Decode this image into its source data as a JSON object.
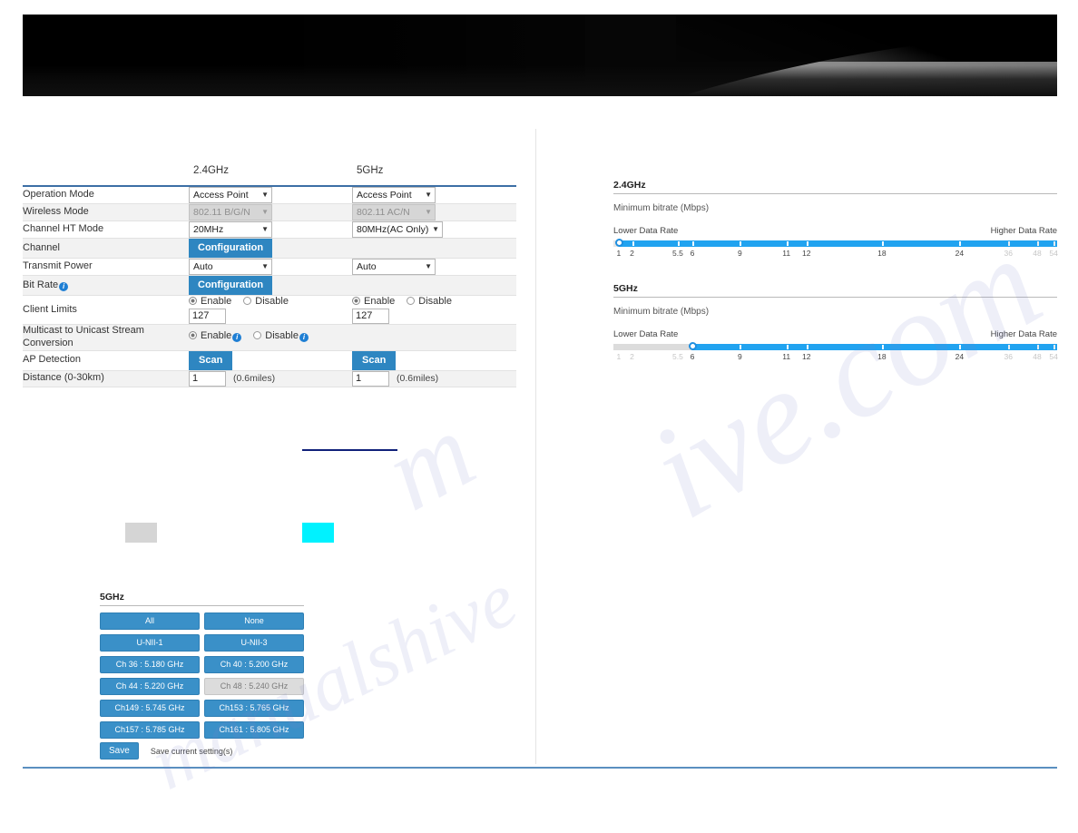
{
  "header": {
    "banner_alt": "product-banner"
  },
  "settings": {
    "columns": {
      "band_24": "2.4GHz",
      "band_5": "5GHz"
    },
    "rows": [
      {
        "label": "Operation Mode",
        "type": "select",
        "c24": {
          "value": "Access Point",
          "disabled": false
        },
        "c5": {
          "value": "Access Point",
          "disabled": false
        }
      },
      {
        "label": "Wireless Mode",
        "type": "select",
        "c24": {
          "value": "802.11 B/G/N",
          "disabled": true
        },
        "c5": {
          "value": "802.11 AC/N",
          "disabled": true
        }
      },
      {
        "label": "Channel HT Mode",
        "type": "select",
        "c24": {
          "value": "20MHz",
          "disabled": false
        },
        "c5": {
          "value": "80MHz(AC Only)",
          "disabled": false
        }
      },
      {
        "label": "Channel",
        "type": "button-span",
        "button_label": "Configuration"
      },
      {
        "label": "Transmit Power",
        "type": "select",
        "c24": {
          "value": "Auto",
          "disabled": false
        },
        "c5": {
          "value": "Auto",
          "disabled": false
        }
      },
      {
        "label": "Bit Rate",
        "type": "button-span",
        "info": true,
        "button_label": "Configuration"
      },
      {
        "label": "Client Limits",
        "type": "radio-input",
        "enable_label": "Enable",
        "disable_label": "Disable",
        "selected": "Enable",
        "c24_value": "127",
        "c5_value": "127"
      },
      {
        "label": "Multicast to Unicast Stream Conversion",
        "type": "radio-info",
        "enable_label": "Enable",
        "disable_label": "Disable",
        "selected": "Enable"
      },
      {
        "label": "AP Detection",
        "type": "scan",
        "button_label": "Scan"
      },
      {
        "label": "Distance (0-30km)",
        "type": "text-unit",
        "c24_value": "1",
        "c5_value": "1",
        "unit": "(0.6miles)"
      }
    ]
  },
  "bitrate": {
    "blocks": [
      {
        "title": "2.4GHz",
        "subtitle": "Minimum bitrate (Mbps)",
        "low_label": "Lower Data Rate",
        "high_label": "Higher Data Rate",
        "ticks": [
          "1",
          "2",
          "5.5",
          "6",
          "9",
          "11",
          "12",
          "18",
          "24",
          "36",
          "48",
          "54"
        ],
        "tick_pct": [
          1.2,
          4.2,
          14.5,
          17.8,
          28.5,
          39.0,
          43.5,
          60.5,
          78.0,
          89.0,
          95.5,
          99.2
        ],
        "faded_from": 9,
        "handle_pct": 1.2,
        "selected": "1"
      },
      {
        "title": "5GHz",
        "subtitle": "Minimum bitrate (Mbps)",
        "low_label": "Lower Data Rate",
        "high_label": "Higher Data Rate",
        "ticks": [
          "1",
          "2",
          "5.5",
          "6",
          "9",
          "11",
          "12",
          "18",
          "24",
          "36",
          "48",
          "54"
        ],
        "tick_pct": [
          1.2,
          4.2,
          14.5,
          17.8,
          28.5,
          39.0,
          43.5,
          60.5,
          78.0,
          89.0,
          95.5,
          99.2
        ],
        "faded_from": 9,
        "handle_pct": 17.8,
        "selected": "6"
      }
    ]
  },
  "channel_panel": {
    "title": "5GHz",
    "rows": [
      [
        {
          "label": "All",
          "disabled": false
        },
        {
          "label": "None",
          "disabled": false
        }
      ],
      [
        {
          "label": "U-NII-1",
          "disabled": false
        },
        {
          "label": "U-NII-3",
          "disabled": false
        }
      ],
      [
        {
          "label": "Ch 36 : 5.180 GHz",
          "disabled": false
        },
        {
          "label": "Ch 40 : 5.200 GHz",
          "disabled": false
        }
      ],
      [
        {
          "label": "Ch 44 : 5.220 GHz",
          "disabled": false
        },
        {
          "label": "Ch 48 : 5.240 GHz",
          "disabled": true
        }
      ],
      [
        {
          "label": "Ch149 : 5.745 GHz",
          "disabled": false
        },
        {
          "label": "Ch153 : 5.765 GHz",
          "disabled": false
        }
      ],
      [
        {
          "label": "Ch157 : 5.785 GHz",
          "disabled": false
        },
        {
          "label": "Ch161 : 5.805 GHz",
          "disabled": false
        }
      ]
    ]
  },
  "save": {
    "button_label": "Save",
    "hint": "Save current setting(s)"
  },
  "colors": {
    "accent_blue": "#2e86c1",
    "button_blue": "#3a90c8",
    "slider_blue": "#21a3f0",
    "swatch_gray": "#d5d5d5",
    "swatch_cyan": "#00f2ff",
    "navy_line": "#10217a",
    "bottom_rule": "#5a8fc0"
  },
  "watermark": {
    "text": "manualshive.com"
  }
}
